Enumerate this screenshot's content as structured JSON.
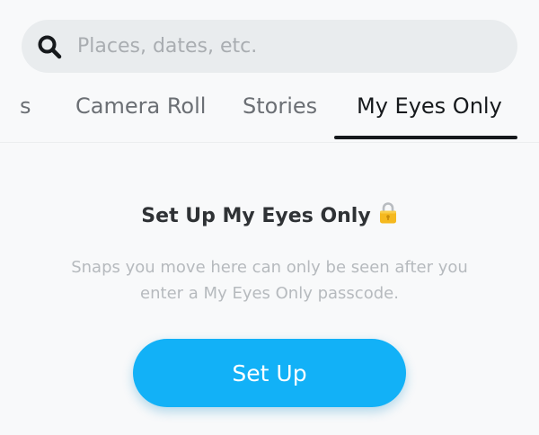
{
  "search": {
    "placeholder": "Places, dates, etc.",
    "icon": "magnifier-icon"
  },
  "tabs": [
    {
      "label": "s",
      "active": false
    },
    {
      "label": "Camera Roll",
      "active": false
    },
    {
      "label": "Stories",
      "active": false
    },
    {
      "label": "My Eyes Only",
      "active": true
    }
  ],
  "empty_state": {
    "title": "Set Up My Eyes Only",
    "title_icon": "lock-icon",
    "description": "Snaps you move here can only be seen after you enter a My Eyes Only passcode.",
    "button_label": "Set Up"
  },
  "colors": {
    "background": "#f8f9fa",
    "search_bg": "#e9ecee",
    "accent": "#12b1f7",
    "active_text": "#16191c",
    "inactive_text": "#6b6f74",
    "muted_text": "#b6babe"
  }
}
